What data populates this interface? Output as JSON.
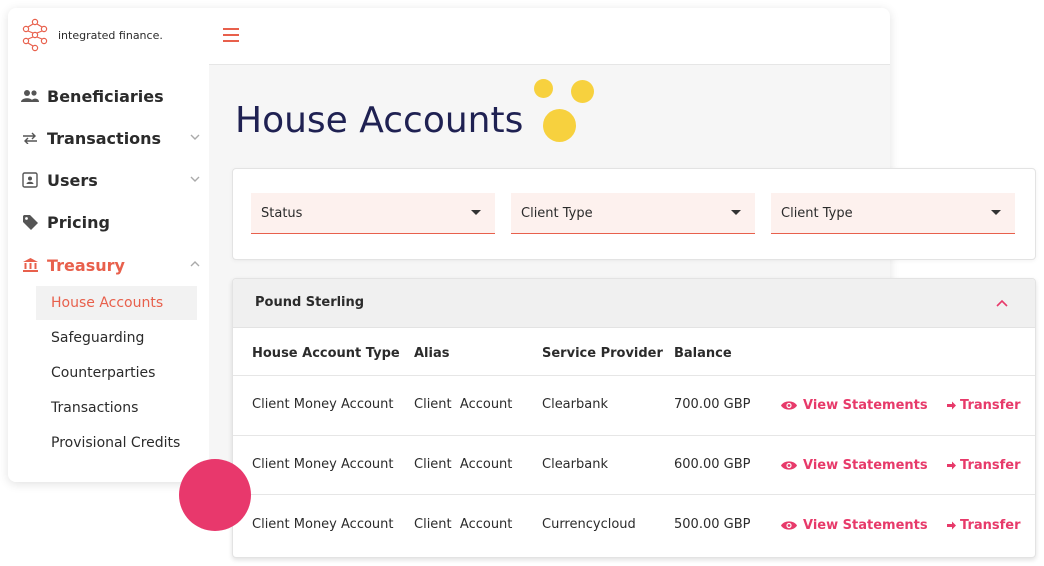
{
  "app": {
    "logo_text": "integrated finance."
  },
  "sidebar": {
    "items": [
      {
        "label": "Beneficiaries",
        "icon": "people-icon"
      },
      {
        "label": "Transactions",
        "icon": "swap-arrows-icon"
      },
      {
        "label": "Users",
        "icon": "id-card-icon"
      },
      {
        "label": "Pricing",
        "icon": "tag-icon"
      },
      {
        "label": "Treasury",
        "icon": "bank-icon"
      }
    ],
    "treasury_subitems": [
      {
        "label": "House Accounts"
      },
      {
        "label": "Safeguarding"
      },
      {
        "label": "Counterparties"
      },
      {
        "label": "Transactions"
      },
      {
        "label": "Provisional Credits"
      }
    ]
  },
  "page": {
    "title": "House Accounts"
  },
  "filters": [
    {
      "label": "Status"
    },
    {
      "label": "Client Type"
    },
    {
      "label": "Client Type"
    }
  ],
  "accounts": {
    "section_title": "Pound Sterling",
    "headers": [
      "House Account Type",
      "Alias",
      "Service Provider",
      "Balance"
    ],
    "rows": [
      {
        "type": "Client Money Account",
        "alias": "Client  Account",
        "provider": "Clearbank",
        "balance": "700.00 GBP"
      },
      {
        "type": "Client Money Account",
        "alias": "Client  Account",
        "provider": "Clearbank",
        "balance": "600.00 GBP"
      },
      {
        "type": "Client Money Account",
        "alias": "Client  Account",
        "provider": "Currencycloud",
        "balance": "500.00 GBP"
      }
    ],
    "view_statements_label": "View Statements",
    "transfer_label": "Transfer"
  },
  "colors": {
    "accent": "#e8604c",
    "link": "#e73a6a",
    "title": "#1f2152",
    "decor_yellow": "#f7d13e",
    "decor_pink": "#e8386c"
  }
}
